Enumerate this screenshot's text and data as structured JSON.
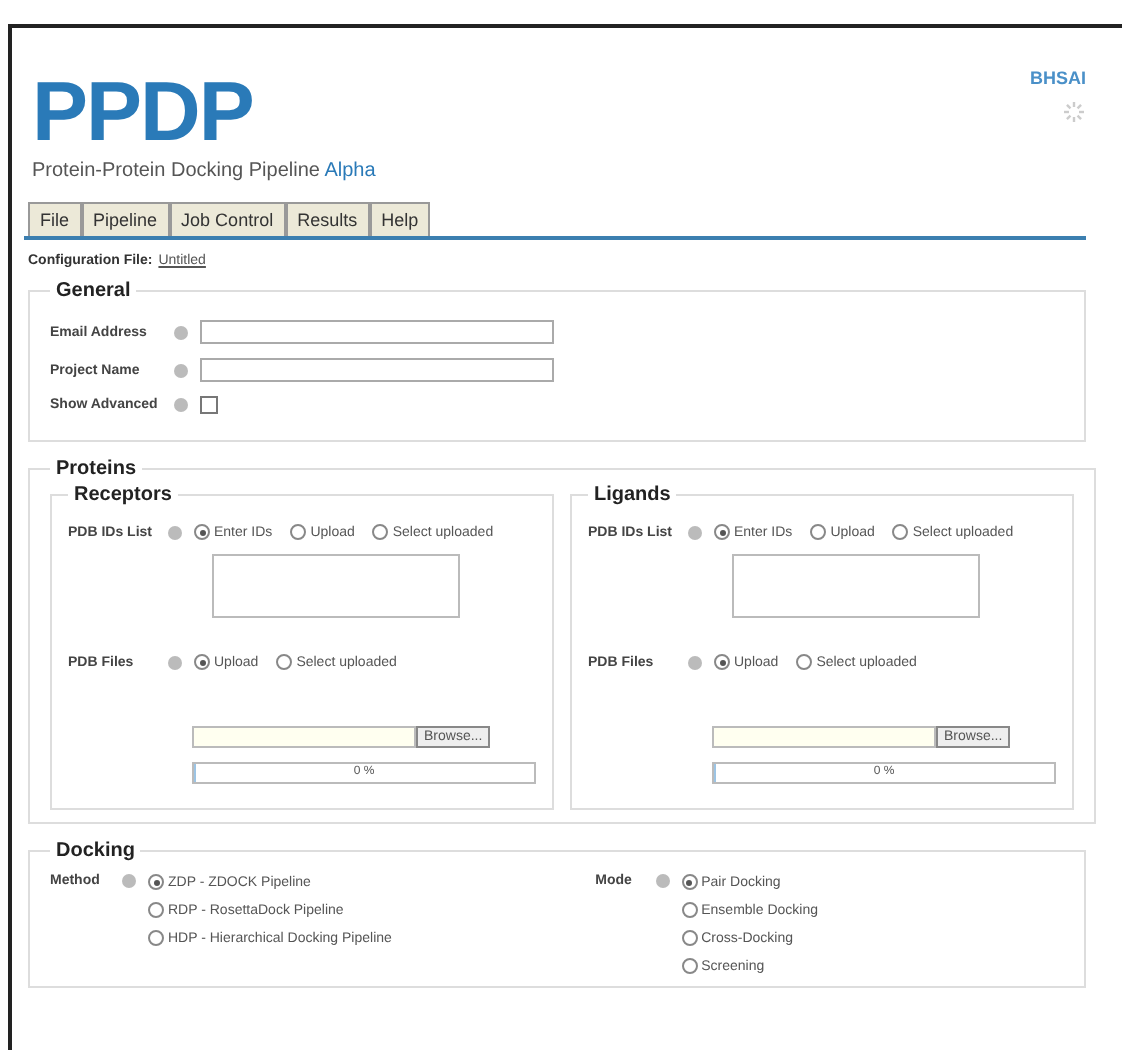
{
  "header": {
    "title": "PPDP",
    "subtitle": "Protein-Protein Docking Pipeline",
    "subtitle_tag": "Alpha",
    "org": "BHSAI"
  },
  "menu": [
    {
      "label": "File",
      "selected": false
    },
    {
      "label": "Pipeline",
      "selected": false
    },
    {
      "label": "Job Control",
      "selected": false
    },
    {
      "label": "Results",
      "selected": false
    },
    {
      "label": "Help",
      "selected": false
    }
  ],
  "config": {
    "label": "Configuration File:",
    "value": "Untitled"
  },
  "general": {
    "legend": "General",
    "email_label": "Email Address",
    "project_label": "Project Name",
    "advanced_label": "Show Advanced",
    "advanced_checked": false
  },
  "proteins": {
    "legend": "Proteins",
    "groups": [
      {
        "legend": "Receptors",
        "ids_label": "PDB IDs List",
        "ids_options": [
          {
            "label": "Enter IDs",
            "selected": true
          },
          {
            "label": "Upload",
            "selected": false
          },
          {
            "label": "Select uploaded",
            "selected": false
          }
        ],
        "files_label": "PDB Files",
        "files_options": [
          {
            "label": "Upload",
            "selected": true
          },
          {
            "label": "Select uploaded",
            "selected": false
          }
        ],
        "browse": "Browse...",
        "progress": "0 %",
        "level": 0
      },
      {
        "legend": "Ligands",
        "ids_label": "PDB IDs List",
        "ids_options": [
          {
            "label": "Enter IDs",
            "selected": true
          },
          {
            "label": "Upload",
            "selected": false
          },
          {
            "label": "Select uploaded",
            "selected": false
          }
        ],
        "files_label": "PDB Files",
        "files_options": [
          {
            "label": "Upload",
            "selected": true
          },
          {
            "label": "Select uploaded",
            "selected": false
          }
        ],
        "browse": "Browse...",
        "progress": "0 %",
        "level": 0
      }
    ]
  },
  "docking": {
    "legend": "Docking",
    "method_label": "Method",
    "methods": [
      {
        "label": "ZDP - ZDOCK Pipeline",
        "selected": true
      },
      {
        "label": "RDP - RosettaDock Pipeline",
        "selected": false
      },
      {
        "label": "HDP - Hierarchical Docking Pipeline",
        "selected": false
      }
    ],
    "mode_label": "Mode",
    "modes": [
      {
        "label": "Pair Docking",
        "selected": true
      },
      {
        "label": "Ensemble Docking",
        "selected": false
      },
      {
        "label": "Cross-Docking",
        "selected": false
      },
      {
        "label": "Screening",
        "selected": false
      }
    ]
  }
}
